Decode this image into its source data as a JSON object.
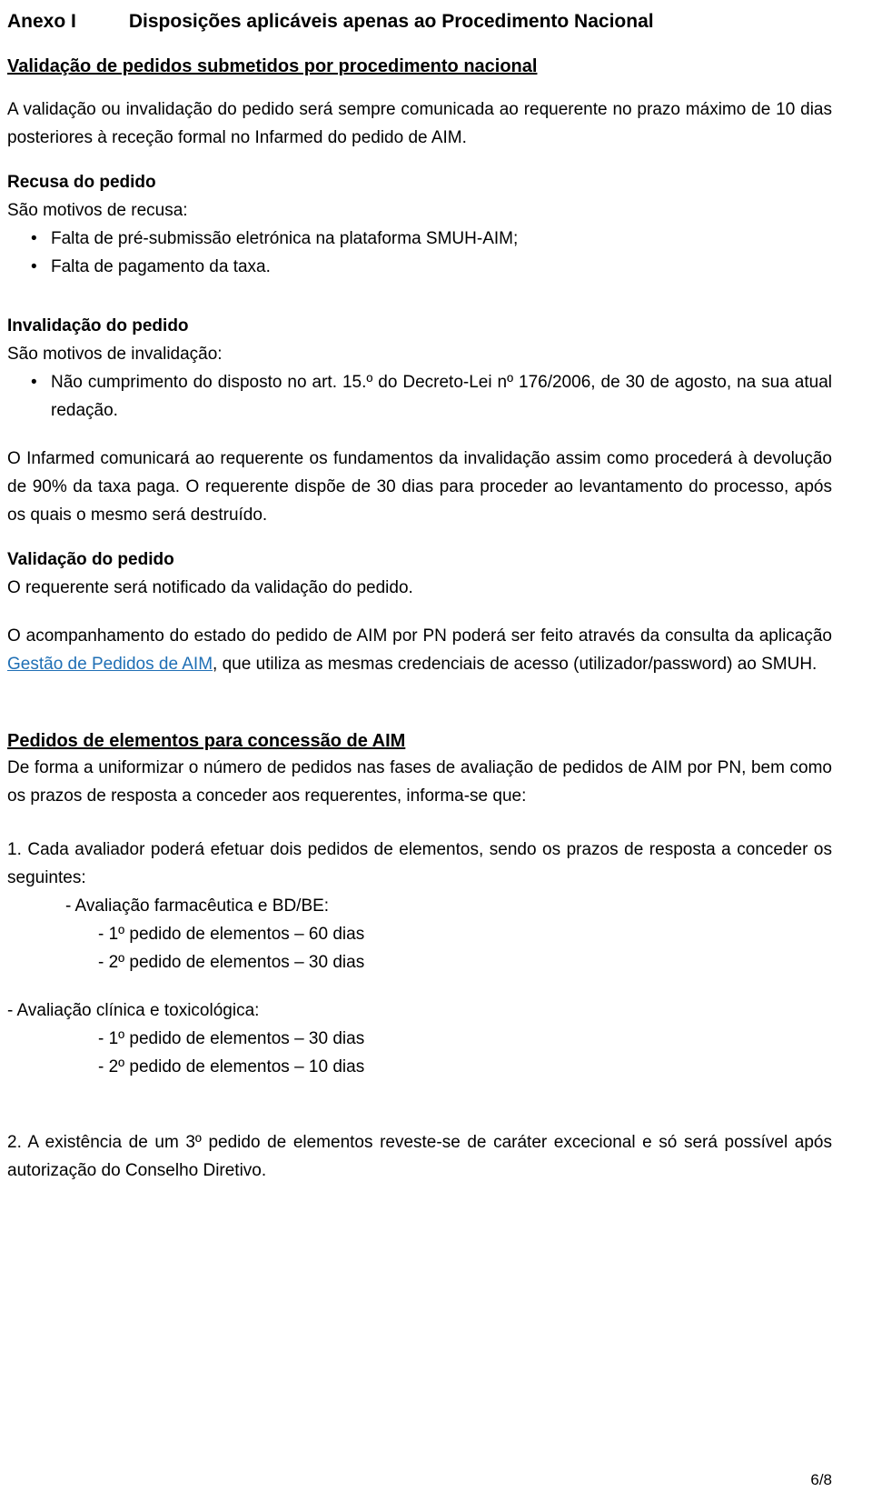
{
  "document": {
    "annex_label": "Anexo I",
    "annex_title": "Disposições aplicáveis apenas ao Procedimento Nacional",
    "section_validacao_heading": "Validação de pedidos submetidos por procedimento nacional",
    "intro_paragraph": "A validação ou invalidação do pedido será sempre comunicada ao requerente no prazo máximo de 10 dias posteriores à receção formal no Infarmed do pedido de AIM.",
    "recusa": {
      "heading": "Recusa do pedido",
      "lead": "São motivos de recusa:",
      "items": [
        "Falta de pré-submissão eletrónica na plataforma SMUH-AIM;",
        "Falta de pagamento da taxa."
      ]
    },
    "invalidacao": {
      "heading": "Invalidação do pedido",
      "lead": "São motivos de invalidação:",
      "items": [
        "Não cumprimento do disposto no art. 15.º do Decreto-Lei nº 176/2006, de 30 de agosto, na sua atual redação."
      ],
      "paragraph": "O Infarmed comunicará ao requerente os fundamentos da invalidação assim como procederá à devolução de 90% da taxa paga. O requerente dispõe de 30 dias para proceder ao levantamento do processo, após os quais o mesmo será destruído."
    },
    "validacao": {
      "heading": "Validação do pedido",
      "paragraph": "O requerente será notificado da validação do pedido."
    },
    "acompanhamento": {
      "text_before_link": "O acompanhamento do estado do pedido de AIM por PN poderá ser feito através da consulta da aplicação ",
      "link_text": "Gestão de Pedidos de AIM",
      "text_after_link": ", que utiliza as mesmas credenciais de acesso (utilizador/password) ao SMUH."
    },
    "pedidos_elementos": {
      "heading": "Pedidos de elementos para concessão de AIM",
      "intro": "De forma a uniformizar o número de pedidos nas fases de avaliação de pedidos de AIM por PN, bem como os prazos de resposta a conceder aos requerentes, informa-se que:",
      "item1": "1. Cada avaliador poderá efetuar dois pedidos de elementos, sendo os prazos de resposta a conceder os seguintes:",
      "group_a_label": "- Avaliação farmacêutica e BD/BE:",
      "group_a_lines": [
        "- 1º pedido de elementos – 60 dias",
        "- 2º  pedido de elementos – 30 dias"
      ],
      "group_b_label": "- Avaliação clínica e toxicológica:",
      "group_b_lines": [
        "- 1º pedido de elementos – 30 dias",
        "- 2º pedido de elementos – 10 dias"
      ],
      "item2": "2. A existência de um 3º pedido de elementos reveste-se de caráter excecional e só será possível após autorização do Conselho Diretivo."
    },
    "footer": {
      "page_number": "6/8"
    }
  }
}
